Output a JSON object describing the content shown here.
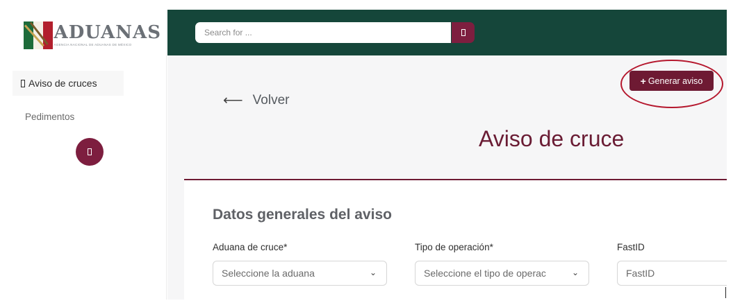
{
  "logo": {
    "title": "ADUANAS",
    "subtitle": "AGENCIA NACIONAL DE ADUANAS DE MÉXICO"
  },
  "sidebar": {
    "items": [
      {
        "label": "Aviso de cruces",
        "icon": "nav-glyph-icon",
        "active": true
      },
      {
        "label": "Pedimentos",
        "active": false
      }
    ],
    "toggle_icon": "sidebar-toggle-icon"
  },
  "header": {
    "search_placeholder": "Search for ...",
    "search_icon": "search-icon"
  },
  "main": {
    "back_label": "Volver",
    "generate_button_label": "Generar aviso",
    "page_title": "Aviso de cruce",
    "section_title": "Datos generales del aviso",
    "fields": [
      {
        "label": "Aduana de cruce*",
        "value": "Seleccione la aduana"
      },
      {
        "label": "Tipo de operación*",
        "value": "Seleccione el tipo de operac"
      },
      {
        "label": "FastID",
        "value": "FastID"
      }
    ]
  },
  "colors": {
    "brand_green": "#15463a",
    "brand_maroon": "#6e1a33",
    "highlight_red": "#b5172d"
  }
}
